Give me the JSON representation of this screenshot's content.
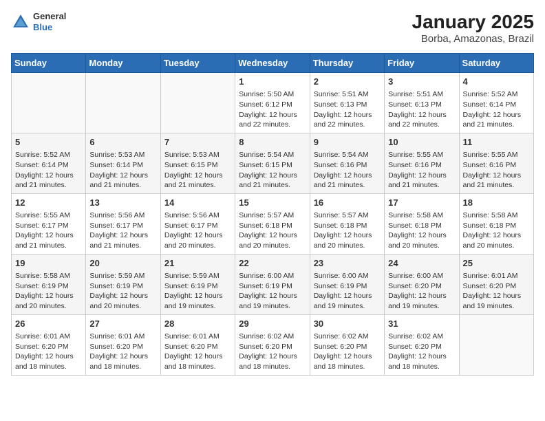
{
  "header": {
    "logo": {
      "line1": "General",
      "line2": "Blue"
    },
    "title": "January 2025",
    "subtitle": "Borba, Amazonas, Brazil"
  },
  "weekdays": [
    "Sunday",
    "Monday",
    "Tuesday",
    "Wednesday",
    "Thursday",
    "Friday",
    "Saturday"
  ],
  "weeks": [
    [
      {
        "day": "",
        "info": ""
      },
      {
        "day": "",
        "info": ""
      },
      {
        "day": "",
        "info": ""
      },
      {
        "day": "1",
        "info": "Sunrise: 5:50 AM\nSunset: 6:12 PM\nDaylight: 12 hours and 22 minutes."
      },
      {
        "day": "2",
        "info": "Sunrise: 5:51 AM\nSunset: 6:13 PM\nDaylight: 12 hours and 22 minutes."
      },
      {
        "day": "3",
        "info": "Sunrise: 5:51 AM\nSunset: 6:13 PM\nDaylight: 12 hours and 22 minutes."
      },
      {
        "day": "4",
        "info": "Sunrise: 5:52 AM\nSunset: 6:14 PM\nDaylight: 12 hours and 21 minutes."
      }
    ],
    [
      {
        "day": "5",
        "info": "Sunrise: 5:52 AM\nSunset: 6:14 PM\nDaylight: 12 hours and 21 minutes."
      },
      {
        "day": "6",
        "info": "Sunrise: 5:53 AM\nSunset: 6:14 PM\nDaylight: 12 hours and 21 minutes."
      },
      {
        "day": "7",
        "info": "Sunrise: 5:53 AM\nSunset: 6:15 PM\nDaylight: 12 hours and 21 minutes."
      },
      {
        "day": "8",
        "info": "Sunrise: 5:54 AM\nSunset: 6:15 PM\nDaylight: 12 hours and 21 minutes."
      },
      {
        "day": "9",
        "info": "Sunrise: 5:54 AM\nSunset: 6:16 PM\nDaylight: 12 hours and 21 minutes."
      },
      {
        "day": "10",
        "info": "Sunrise: 5:55 AM\nSunset: 6:16 PM\nDaylight: 12 hours and 21 minutes."
      },
      {
        "day": "11",
        "info": "Sunrise: 5:55 AM\nSunset: 6:16 PM\nDaylight: 12 hours and 21 minutes."
      }
    ],
    [
      {
        "day": "12",
        "info": "Sunrise: 5:55 AM\nSunset: 6:17 PM\nDaylight: 12 hours and 21 minutes."
      },
      {
        "day": "13",
        "info": "Sunrise: 5:56 AM\nSunset: 6:17 PM\nDaylight: 12 hours and 21 minutes."
      },
      {
        "day": "14",
        "info": "Sunrise: 5:56 AM\nSunset: 6:17 PM\nDaylight: 12 hours and 20 minutes."
      },
      {
        "day": "15",
        "info": "Sunrise: 5:57 AM\nSunset: 6:18 PM\nDaylight: 12 hours and 20 minutes."
      },
      {
        "day": "16",
        "info": "Sunrise: 5:57 AM\nSunset: 6:18 PM\nDaylight: 12 hours and 20 minutes."
      },
      {
        "day": "17",
        "info": "Sunrise: 5:58 AM\nSunset: 6:18 PM\nDaylight: 12 hours and 20 minutes."
      },
      {
        "day": "18",
        "info": "Sunrise: 5:58 AM\nSunset: 6:18 PM\nDaylight: 12 hours and 20 minutes."
      }
    ],
    [
      {
        "day": "19",
        "info": "Sunrise: 5:58 AM\nSunset: 6:19 PM\nDaylight: 12 hours and 20 minutes."
      },
      {
        "day": "20",
        "info": "Sunrise: 5:59 AM\nSunset: 6:19 PM\nDaylight: 12 hours and 20 minutes."
      },
      {
        "day": "21",
        "info": "Sunrise: 5:59 AM\nSunset: 6:19 PM\nDaylight: 12 hours and 19 minutes."
      },
      {
        "day": "22",
        "info": "Sunrise: 6:00 AM\nSunset: 6:19 PM\nDaylight: 12 hours and 19 minutes."
      },
      {
        "day": "23",
        "info": "Sunrise: 6:00 AM\nSunset: 6:19 PM\nDaylight: 12 hours and 19 minutes."
      },
      {
        "day": "24",
        "info": "Sunrise: 6:00 AM\nSunset: 6:20 PM\nDaylight: 12 hours and 19 minutes."
      },
      {
        "day": "25",
        "info": "Sunrise: 6:01 AM\nSunset: 6:20 PM\nDaylight: 12 hours and 19 minutes."
      }
    ],
    [
      {
        "day": "26",
        "info": "Sunrise: 6:01 AM\nSunset: 6:20 PM\nDaylight: 12 hours and 18 minutes."
      },
      {
        "day": "27",
        "info": "Sunrise: 6:01 AM\nSunset: 6:20 PM\nDaylight: 12 hours and 18 minutes."
      },
      {
        "day": "28",
        "info": "Sunrise: 6:01 AM\nSunset: 6:20 PM\nDaylight: 12 hours and 18 minutes."
      },
      {
        "day": "29",
        "info": "Sunrise: 6:02 AM\nSunset: 6:20 PM\nDaylight: 12 hours and 18 minutes."
      },
      {
        "day": "30",
        "info": "Sunrise: 6:02 AM\nSunset: 6:20 PM\nDaylight: 12 hours and 18 minutes."
      },
      {
        "day": "31",
        "info": "Sunrise: 6:02 AM\nSunset: 6:20 PM\nDaylight: 12 hours and 18 minutes."
      },
      {
        "day": "",
        "info": ""
      }
    ]
  ]
}
